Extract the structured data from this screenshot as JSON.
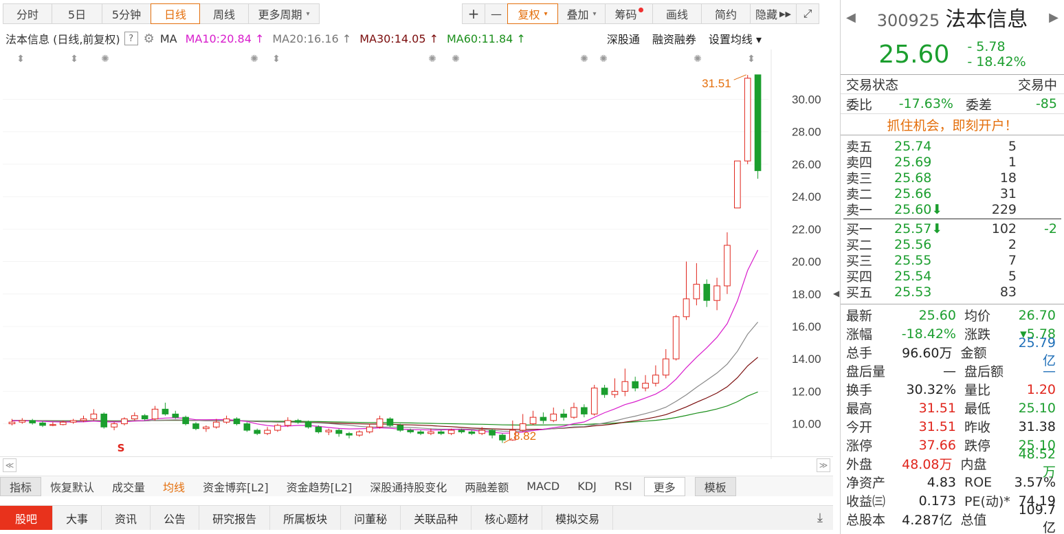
{
  "toolbar": {
    "periods": [
      "分时",
      "5日",
      "5分钟",
      "日线",
      "周线",
      "更多周期"
    ],
    "active_period": "日线",
    "zoom_in": "+",
    "zoom_out": "—",
    "fuquan": "复权",
    "tools": [
      "叠加",
      "筹码",
      "画线",
      "简约",
      "隐藏"
    ]
  },
  "legend": {
    "stock_label": "法本信息 (日线,前复权)",
    "help": "?",
    "ma_title": "MA",
    "ma10": "MA10:20.84",
    "ma20": "MA20:16.16",
    "ma30": "MA30:14.05",
    "ma60": "MA60:11.84",
    "links": [
      "深股通",
      "融资融券",
      "设置均线"
    ]
  },
  "chart_data": {
    "type": "candlestick",
    "y_ticks": [
      "30.00",
      "28.00",
      "26.00",
      "24.00",
      "22.00",
      "20.00",
      "18.00",
      "16.00",
      "14.00",
      "12.00",
      "10.00"
    ],
    "high_annotation": "31.51",
    "low_annotation": "8.82",
    "ylim": [
      8.5,
      31.8
    ],
    "colors": {
      "up": "#e0251c",
      "down": "#1b9e2e",
      "ma10": "#d81ccc",
      "ma20": "#888888",
      "ma30": "#7a0c0c",
      "ma60": "#1b8f1b"
    },
    "candles": [
      [
        10.0,
        10.1,
        10.3,
        9.9
      ],
      [
        10.1,
        10.2,
        10.35,
        10.0
      ],
      [
        10.2,
        10.05,
        10.3,
        9.95
      ],
      [
        10.05,
        9.9,
        10.15,
        9.8
      ],
      [
        9.9,
        9.95,
        10.1,
        9.85
      ],
      [
        9.95,
        10.1,
        10.2,
        9.9
      ],
      [
        10.1,
        10.2,
        10.3,
        10.0
      ],
      [
        10.2,
        10.3,
        10.5,
        10.1
      ],
      [
        10.3,
        10.6,
        10.9,
        10.2
      ],
      [
        10.6,
        9.8,
        10.7,
        9.7
      ],
      [
        9.8,
        10.0,
        10.1,
        9.6
      ],
      [
        10.0,
        10.3,
        10.4,
        9.9
      ],
      [
        10.3,
        10.5,
        10.7,
        10.2
      ],
      [
        10.5,
        10.3,
        10.6,
        10.2
      ],
      [
        10.3,
        10.9,
        11.1,
        10.2
      ],
      [
        10.9,
        10.6,
        11.3,
        10.5
      ],
      [
        10.6,
        10.4,
        10.8,
        10.3
      ],
      [
        10.4,
        10.0,
        10.5,
        9.9
      ],
      [
        10.0,
        9.7,
        10.1,
        9.6
      ],
      [
        9.7,
        9.8,
        9.9,
        9.5
      ],
      [
        9.8,
        10.1,
        10.3,
        9.7
      ],
      [
        10.1,
        10.3,
        10.5,
        10.0
      ],
      [
        10.3,
        10.0,
        10.4,
        9.9
      ],
      [
        10.0,
        9.6,
        10.1,
        9.5
      ],
      [
        9.6,
        9.4,
        9.7,
        9.3
      ],
      [
        9.4,
        9.6,
        9.8,
        9.3
      ],
      [
        9.6,
        9.9,
        10.0,
        9.5
      ],
      [
        9.9,
        10.2,
        10.4,
        9.8
      ],
      [
        10.2,
        10.1,
        10.3,
        10.0
      ],
      [
        10.1,
        9.8,
        10.2,
        9.7
      ],
      [
        9.8,
        9.5,
        9.9,
        9.4
      ],
      [
        9.5,
        9.6,
        9.7,
        9.3
      ],
      [
        9.6,
        9.4,
        9.7,
        9.2
      ],
      [
        9.4,
        9.3,
        9.5,
        9.1
      ],
      [
        9.3,
        9.5,
        9.6,
        9.2
      ],
      [
        9.5,
        9.8,
        10.0,
        9.4
      ],
      [
        9.8,
        10.3,
        10.5,
        9.7
      ],
      [
        10.3,
        9.9,
        10.4,
        9.8
      ],
      [
        9.9,
        9.6,
        10.0,
        9.5
      ],
      [
        9.6,
        9.5,
        9.7,
        9.4
      ],
      [
        9.5,
        9.4,
        9.6,
        9.3
      ],
      [
        9.4,
        9.5,
        9.7,
        9.3
      ],
      [
        9.5,
        9.4,
        9.6,
        9.3
      ],
      [
        9.4,
        9.6,
        9.7,
        9.3
      ],
      [
        9.6,
        9.5,
        9.7,
        9.4
      ],
      [
        9.5,
        9.4,
        9.6,
        9.3
      ],
      [
        9.4,
        9.6,
        9.8,
        9.3
      ],
      [
        9.6,
        9.3,
        9.7,
        9.1
      ],
      [
        9.3,
        9.0,
        9.4,
        8.82
      ],
      [
        9.0,
        9.6,
        10.2,
        8.95
      ],
      [
        9.6,
        10.0,
        10.6,
        9.5
      ],
      [
        10.0,
        10.4,
        10.8,
        9.9
      ],
      [
        10.4,
        10.2,
        10.7,
        10.0
      ],
      [
        10.2,
        10.6,
        11.0,
        10.1
      ],
      [
        10.6,
        10.4,
        10.9,
        10.2
      ],
      [
        10.4,
        11.0,
        11.3,
        10.3
      ],
      [
        11.0,
        10.6,
        11.2,
        10.4
      ],
      [
        10.6,
        12.2,
        12.4,
        10.5
      ],
      [
        12.2,
        11.8,
        12.4,
        11.6
      ],
      [
        11.8,
        12.0,
        12.8,
        11.6
      ],
      [
        12.0,
        12.6,
        13.4,
        11.7
      ],
      [
        12.6,
        12.2,
        12.9,
        12.0
      ],
      [
        12.2,
        12.5,
        13.0,
        12.0
      ],
      [
        12.5,
        13.0,
        13.6,
        12.3
      ],
      [
        13.0,
        14.0,
        14.6,
        12.8
      ],
      [
        14.0,
        16.6,
        16.7,
        13.9
      ],
      [
        16.6,
        17.7,
        20.0,
        16.4
      ],
      [
        17.7,
        18.6,
        19.9,
        17.3
      ],
      [
        18.6,
        17.6,
        18.9,
        17.2
      ],
      [
        17.6,
        18.5,
        19.0,
        17.0
      ],
      [
        18.5,
        21.0,
        21.8,
        18.0
      ],
      [
        23.3,
        26.2,
        26.2,
        23.3
      ],
      [
        26.2,
        31.3,
        31.5,
        26.0
      ],
      [
        31.51,
        25.6,
        31.51,
        25.1
      ]
    ]
  },
  "indicator_tabs": {
    "items": [
      "指标",
      "恢复默认",
      "成交量",
      "均线",
      "资金博弈[L2]",
      "资金趋势[L2]",
      "深股通持股变化",
      "两融差额",
      "MACD",
      "KDJ",
      "RSI",
      "更多",
      "模板"
    ],
    "active": "均线"
  },
  "bottom_tabs": [
    "股吧",
    "大事",
    "资讯",
    "公告",
    "研究报告",
    "所属板块",
    "问董秘",
    "关联品种",
    "核心题材",
    "模拟交易"
  ],
  "quote": {
    "code": "300925",
    "name": "法本信息",
    "price": "25.60",
    "change": "- 5.78",
    "change_pct": "- 18.42%",
    "status_label": "交易状态",
    "status_value": "交易中",
    "weibi_label": "委比",
    "weibi_value": "-17.63%",
    "weicha_label": "委差",
    "weicha_value": "-85",
    "promo": "抓住机会，即刻开户！",
    "asks": [
      {
        "label": "卖五",
        "price": "25.74",
        "vol": "5"
      },
      {
        "label": "卖四",
        "price": "25.69",
        "vol": "1"
      },
      {
        "label": "卖三",
        "price": "25.68",
        "vol": "18"
      },
      {
        "label": "卖二",
        "price": "25.66",
        "vol": "31"
      },
      {
        "label": "卖一",
        "price": "25.60⬇",
        "vol": "229"
      }
    ],
    "bids": [
      {
        "label": "买一",
        "price": "25.57⬇",
        "vol": "102",
        "extra": "-2"
      },
      {
        "label": "买二",
        "price": "25.56",
        "vol": "2"
      },
      {
        "label": "买三",
        "price": "25.55",
        "vol": "7"
      },
      {
        "label": "买四",
        "price": "25.54",
        "vol": "5"
      },
      {
        "label": "买五",
        "price": "25.53",
        "vol": "83"
      }
    ],
    "stats": [
      {
        "k1": "最新",
        "v1": "25.60",
        "c1": "green",
        "k2": "均价",
        "v2": "26.70",
        "c2": "green"
      },
      {
        "k1": "涨幅",
        "v1": "-18.42%",
        "c1": "green",
        "k2": "涨跌",
        "v2": "▾5.78",
        "c2": "green"
      },
      {
        "k1": "总手",
        "v1": "96.60万",
        "c1": "dark",
        "k2": "金额",
        "v2": "25.79亿",
        "c2": "blue"
      },
      {
        "k1": "盘后量",
        "v1": "—",
        "c1": "dark",
        "k2": "盘后额",
        "v2": "—",
        "c2": "blue"
      },
      {
        "k1": "换手",
        "v1": "30.32%",
        "c1": "dark",
        "k2": "量比",
        "v2": "1.20",
        "c2": "red"
      },
      {
        "k1": "最高",
        "v1": "31.51",
        "c1": "red",
        "k2": "最低",
        "v2": "25.10",
        "c2": "green"
      },
      {
        "k1": "今开",
        "v1": "31.51",
        "c1": "red",
        "k2": "昨收",
        "v2": "31.38",
        "c2": "dark"
      },
      {
        "k1": "涨停",
        "v1": "37.66",
        "c1": "red",
        "k2": "跌停",
        "v2": "25.10",
        "c2": "green"
      },
      {
        "k1": "外盘",
        "v1": "48.08万",
        "c1": "red",
        "k2": "内盘",
        "v2": "48.52万",
        "c2": "green"
      },
      {
        "k1": "净资产",
        "v1": "4.83",
        "c1": "dark",
        "k2": "ROE",
        "v2": "3.57%",
        "c2": "dark"
      },
      {
        "k1": "收益㈢",
        "v1": "0.173",
        "c1": "dark",
        "k2": "PE(动)*",
        "v2": "74.19",
        "c2": "dark"
      },
      {
        "k1": "总股本",
        "v1": "4.287亿",
        "c1": "dark",
        "k2": "总值",
        "v2": "109.7亿",
        "c2": "dark"
      }
    ]
  }
}
